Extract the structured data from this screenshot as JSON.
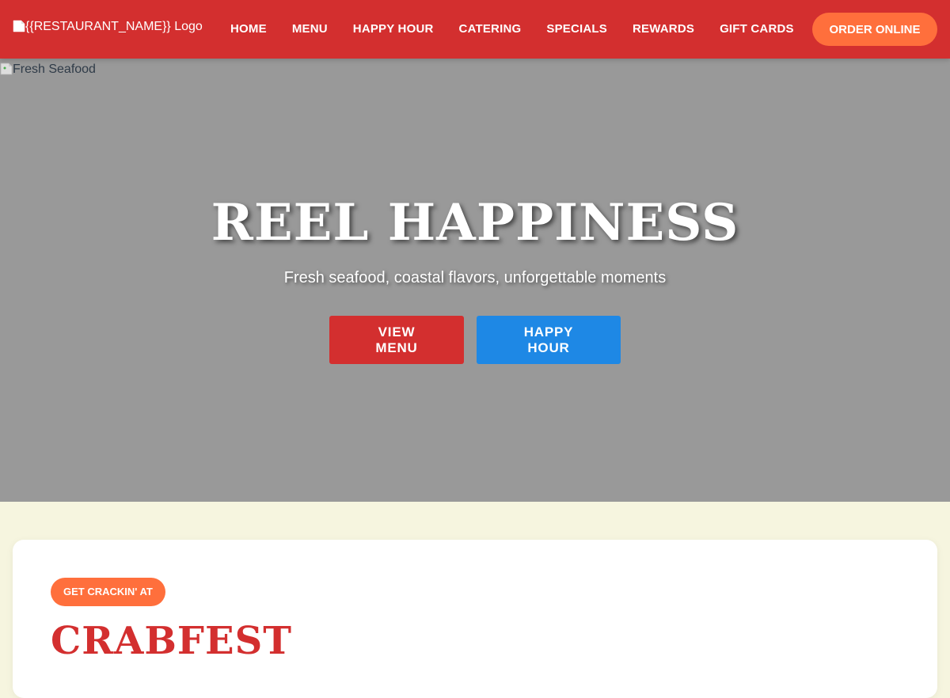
{
  "header": {
    "logo_alt": "{{RESTAURANT_NAME}} Logo",
    "nav": [
      "HOME",
      "MENU",
      "HAPPY HOUR",
      "CATERING",
      "SPECIALS",
      "REWARDS",
      "GIFT CARDS"
    ],
    "order_button": "ORDER ONLINE"
  },
  "hero": {
    "image_alt": "Fresh Seafood",
    "title": "REEL HAPPINESS",
    "subtitle": "Fresh seafood, coastal flavors, unforgettable moments",
    "buttons": [
      "VIEW MENU",
      "HAPPY HOUR"
    ]
  },
  "promo": {
    "badge": "GET CRACKIN' AT",
    "title": "CRABFEST"
  },
  "colors": {
    "header_bg": "#d32f2f",
    "order_button": "#ff6f3c",
    "hero_overlay": "#999999",
    "view_menu_button": "#d32f2f",
    "happy_hour_button": "#1e88e5",
    "page_bg": "#f6f5df",
    "card_bg": "#ffffff"
  },
  "icons": {
    "logo": "broken-image-icon",
    "hero": "broken-image-icon"
  }
}
